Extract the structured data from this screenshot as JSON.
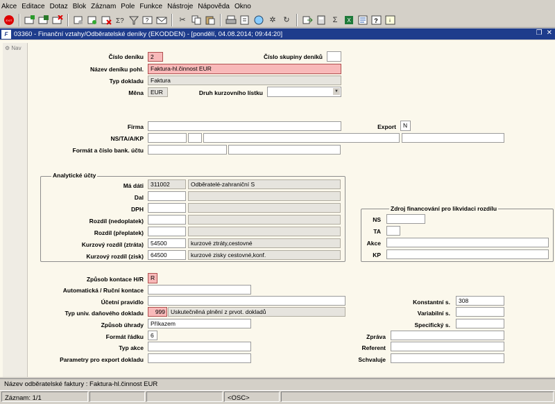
{
  "menu": [
    "Akce",
    "Editace",
    "Dotaz",
    "Blok",
    "Záznam",
    "Pole",
    "Funkce",
    "Nástroje",
    "Nápověda",
    "Okno"
  ],
  "window": {
    "title": "03360 - Finanční vztahy/Odběratelské deníky (EKODDEN) - [pondělí, 04.08.2014; 09:44:20]",
    "logo": "F",
    "nav_label": "Nav"
  },
  "form": {
    "cislo_deniku": {
      "label": "Číslo deníku",
      "value": "2"
    },
    "cislo_skupiny": {
      "label": "Číslo skupiny deníků",
      "value": ""
    },
    "nazev_deniku": {
      "label": "Název deníku pohl.",
      "value": "Faktura-hl.činnost EUR"
    },
    "typ_dokladu": {
      "label": "Typ dokladu",
      "value": "Faktura"
    },
    "mena": {
      "label": "Měna",
      "value": "EUR"
    },
    "druh_kurz": {
      "label": "Druh kurzovního lístku",
      "value": ""
    },
    "firma": {
      "label": "Firma",
      "value": ""
    },
    "export": {
      "label": "Export",
      "value": "N"
    },
    "ns_ta": {
      "label": "NS/TA/A/KP"
    },
    "format_banky": {
      "label": "Formát a číslo bank. účtu"
    },
    "analyticke": {
      "title": "Analytické účty",
      "rows": [
        {
          "label": "Má dáti",
          "code": "311002",
          "desc": "Odběratelé-zahraniční          S"
        },
        {
          "label": "Dal",
          "code": "",
          "desc": ""
        },
        {
          "label": "DPH",
          "code": "",
          "desc": ""
        },
        {
          "label": "Rozdíl (nedoplatek)",
          "code": "",
          "desc": ""
        },
        {
          "label": "Rozdíl (přeplatek)",
          "code": "",
          "desc": ""
        },
        {
          "label": "Kurzový rozdíl (ztráta)",
          "code": "54500",
          "desc": "kurzové ztráty,cestovné"
        },
        {
          "label": "Kurzový rozdíl (zisk)",
          "code": "64500",
          "desc": "kurzové zisky cestovné,konf."
        }
      ]
    },
    "zdroj": {
      "title": "Zdroj financování pro likvidaci rozdílu",
      "rows": [
        {
          "label": "NS"
        },
        {
          "label": "TA"
        },
        {
          "label": "Akce"
        },
        {
          "label": "KP"
        }
      ]
    },
    "zpusob_kontace": {
      "label": "Způsob kontace H/R",
      "value": "R"
    },
    "auto_rucni": {
      "label": "Automatická / Ruční kontace",
      "value": ""
    },
    "ucetni_pravidlo": {
      "label": "Účetní pravidlo",
      "value": ""
    },
    "typ_univ": {
      "label": "Typ univ. daňového dokladu",
      "code": "999",
      "desc": "Uskutečněná plnění z prvot. dokladů"
    },
    "zpusob_uhrady": {
      "label": "Způsob úhrady",
      "value": "Příkazem"
    },
    "format_radku": {
      "label": "Formát řádku",
      "value": "6"
    },
    "typ_akce": {
      "label": "Typ akce",
      "value": ""
    },
    "parametry": {
      "label": "Parametry pro export dokladu",
      "value": ""
    },
    "konstantni": {
      "label": "Konstantní s.",
      "value": "308"
    },
    "variabilni": {
      "label": "Variabilní s.",
      "value": ""
    },
    "specificky": {
      "label": "Specifický s.",
      "value": ""
    },
    "zprava": {
      "label": "Zpráva",
      "value": ""
    },
    "referent": {
      "label": "Referent",
      "value": ""
    },
    "schvaluje": {
      "label": "Schvaluje",
      "value": ""
    }
  },
  "status": {
    "message": "Název odběratelské faktury : Faktura-hl.činnost EUR",
    "record": "Záznam: 1/1",
    "osc": "<OSC>"
  },
  "colors": {
    "title_bar": "#1e3c8c",
    "required_field": "#f8b9b9",
    "form_bg": "#fbf8ec"
  }
}
